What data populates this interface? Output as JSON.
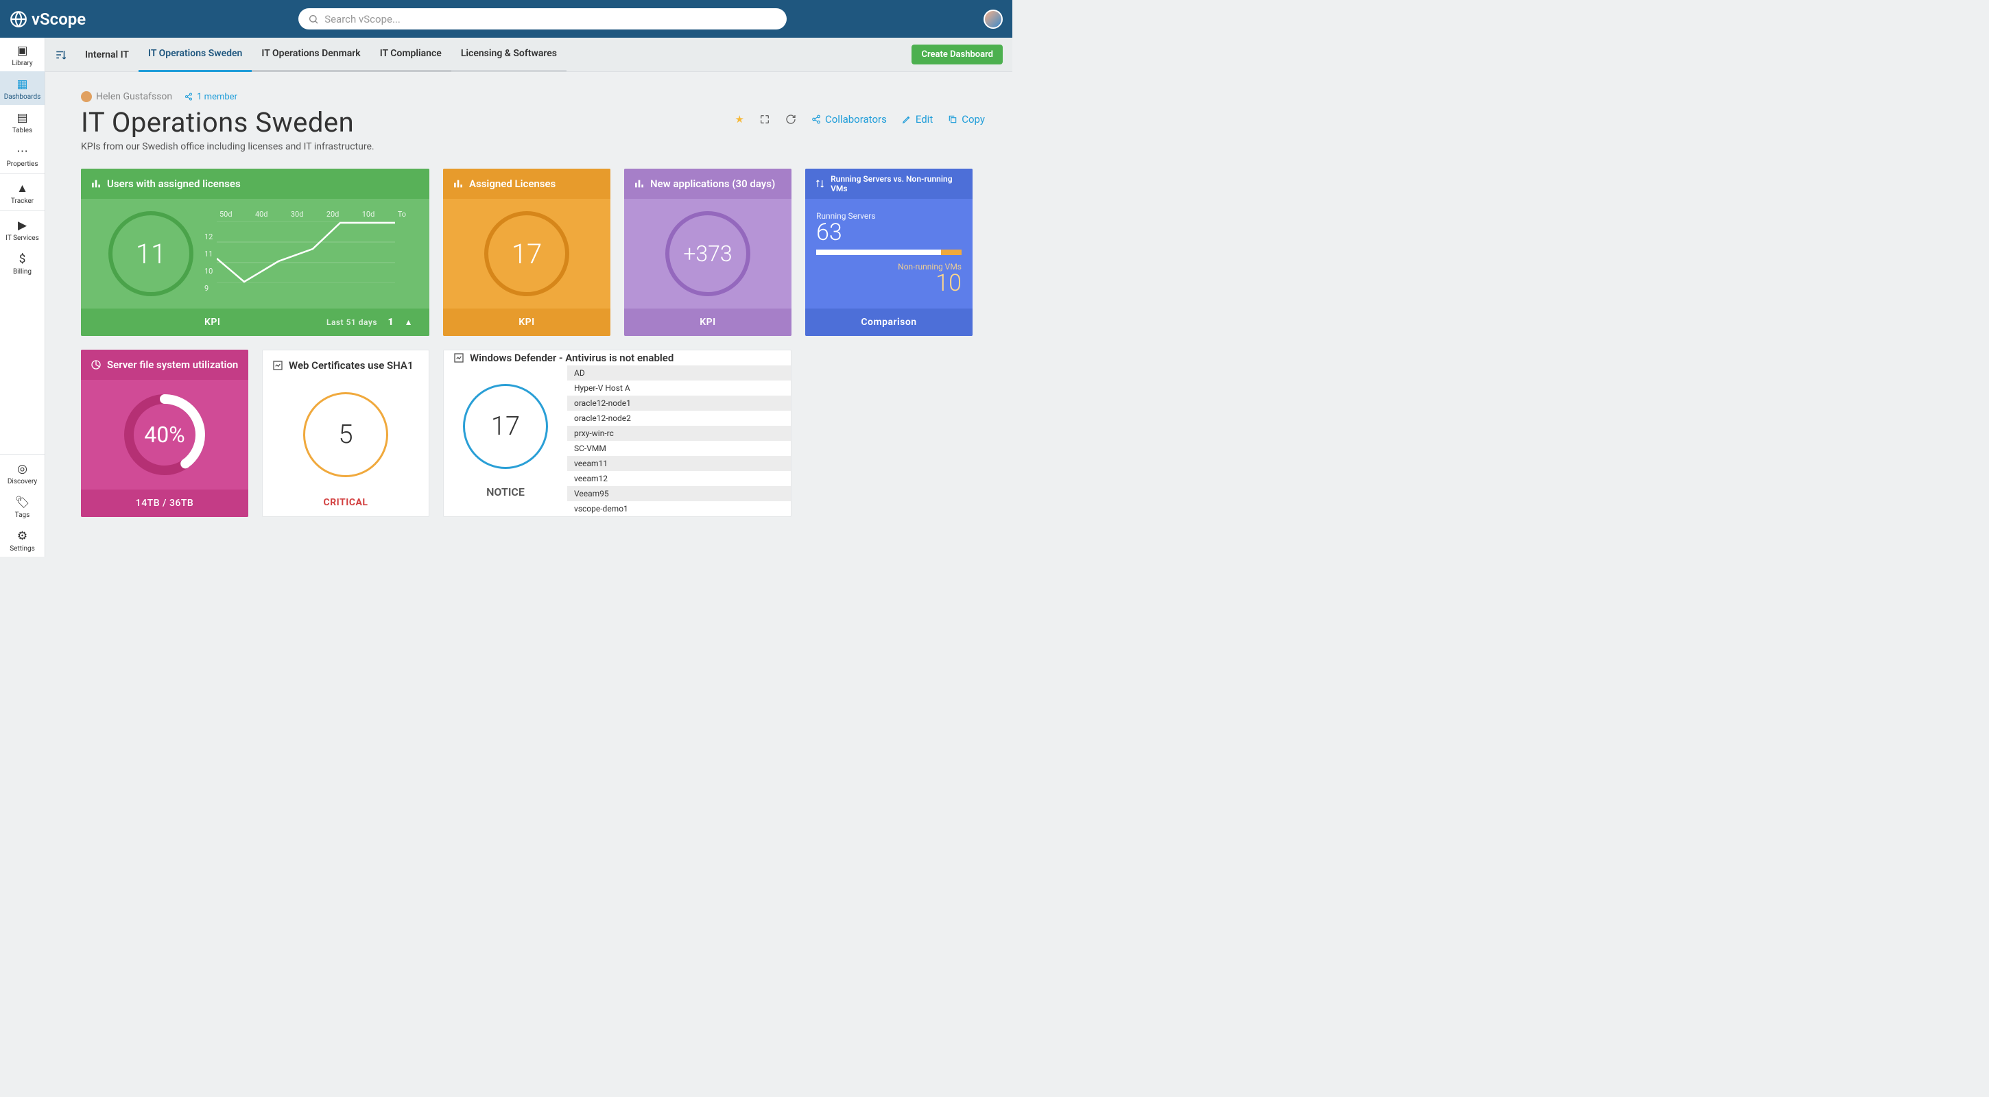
{
  "brand": "vScope",
  "search": {
    "placeholder": "Search vScope..."
  },
  "sidenav": [
    {
      "label": "Library"
    },
    {
      "label": "Dashboards"
    },
    {
      "label": "Tables"
    },
    {
      "label": "Properties"
    },
    {
      "label": "Tracker"
    },
    {
      "label": "IT Services"
    },
    {
      "label": "Billing"
    }
  ],
  "sidenav_bottom": [
    {
      "label": "Discovery"
    },
    {
      "label": "Tags"
    },
    {
      "label": "Settings"
    }
  ],
  "tabs": [
    "Internal IT",
    "IT Operations Sweden",
    "IT Operations Denmark",
    "IT Compliance",
    "Licensing & Softwares"
  ],
  "create_btn": "Create Dashboard",
  "owner": "Helen Gustafsson",
  "members": "1 member",
  "title": "IT Operations Sweden",
  "subtitle": "KPIs from our Swedish office including licenses and IT infrastructure.",
  "actions": {
    "collab": "Collaborators",
    "edit": "Edit",
    "copy": "Copy"
  },
  "cards": {
    "users_lic": {
      "title": "Users with assigned licenses",
      "value": "11",
      "footer": "KPI",
      "trend": "Last 51 days",
      "trend_n": "1"
    },
    "assigned": {
      "title": "Assigned Licenses",
      "value": "17",
      "footer": "KPI"
    },
    "newapps": {
      "title": "New applications (30 days)",
      "value": "+373",
      "footer": "KPI"
    },
    "running": {
      "title": "Running Servers vs. Non-running VMs",
      "a_label": "Running Servers",
      "a_val": "63",
      "b_label": "Non-running VMs",
      "b_val": "10",
      "footer": "Comparison"
    },
    "serverfs": {
      "title": "Server file system utilization",
      "value": "40%",
      "footer": "14TB / 36TB"
    },
    "sha1": {
      "title": "Web Certificates use SHA1",
      "value": "5",
      "footer": "CRITICAL"
    },
    "defender": {
      "title": "Windows Defender - Antivirus is not enabled",
      "value": "17",
      "footer": "NOTICE",
      "items": [
        "AD",
        "Hyper-V Host A",
        "oracle12-node1",
        "oracle12-node2",
        "prxy-win-rc",
        "SC-VMM",
        "veeam11",
        "veeam12",
        "Veeam95",
        "vscope-demo1"
      ]
    }
  },
  "chart_data": {
    "type": "line",
    "title": "Users with assigned licenses trend",
    "x_labels": [
      "50d",
      "40d",
      "30d",
      "20d",
      "10d",
      "To"
    ],
    "y_ticks": [
      12,
      11,
      10,
      9
    ],
    "ylim": [
      9,
      12
    ],
    "values": [
      10.2,
      9.1,
      10.1,
      10.8,
      12,
      12,
      12
    ]
  }
}
